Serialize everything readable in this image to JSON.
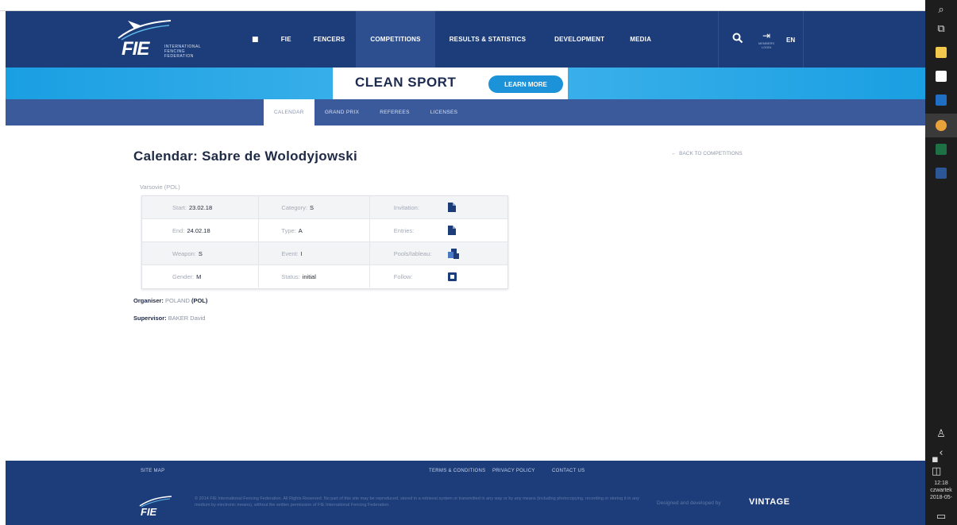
{
  "header": {
    "logo_text": "FIE",
    "logo_subtext": [
      "INTERNATIONAL",
      "FENCING",
      "FEDERATION"
    ],
    "nav": [
      {
        "label": "FIE"
      },
      {
        "label": "FENCERS"
      },
      {
        "label": "COMPETITIONS",
        "active": true
      },
      {
        "label": "RESULTS & STATISTICS"
      },
      {
        "label": "DEVELOPMENT"
      },
      {
        "label": "MEDIA"
      }
    ],
    "login_label": [
      "MEMBERS",
      "LOGIN"
    ],
    "language": "EN"
  },
  "banner": {
    "title": "CLEAN SPORT",
    "button": "LEARN MORE"
  },
  "subnav": [
    {
      "label": "CALENDAR",
      "active": true
    },
    {
      "label": "GRAND PRIX"
    },
    {
      "label": "REFEREES"
    },
    {
      "label": "LICENSES"
    }
  ],
  "main": {
    "title": "Calendar: Sabre de Wolodyjowski",
    "back_link": "BACK TO COMPETITIONS",
    "location": "Varsovie (POL)",
    "rows": [
      {
        "k1": "Start:",
        "v1": "23.02.18",
        "k2": "Category:",
        "v2": "S",
        "k3": "Invitation:",
        "icon": "document-icon"
      },
      {
        "k1": "End:",
        "v1": "24.02.18",
        "k2": "Type:",
        "v2": "A",
        "k3": "Entries:",
        "icon": "document-icon"
      },
      {
        "k1": "Weapon:",
        "v1": "S",
        "k2": "Event:",
        "v2": "I",
        "k3": "Pools/tableau:",
        "icon": "tableau-icon"
      },
      {
        "k1": "Gender:",
        "v1": "M",
        "k2": "Status:",
        "v2": "initial",
        "k3": "Follow:",
        "icon": "follow-icon"
      }
    ],
    "organiser_label": "Organiser:",
    "organiser_value": "POLAND",
    "organiser_code": "(POL)",
    "supervisor_label": "Supervisor:",
    "supervisor_value": "BAKER David"
  },
  "footer": {
    "site_map": "SITE MAP",
    "terms": "TERMS & CONDITIONS",
    "privacy": "PRIVACY POLICY",
    "contact": "CONTACT US",
    "copyright": "© 2014 FIE International Fencing Federation. All Rights Reserved. No part of this site may be reproduced, stored in a retrieval system or transmitted in any way or by any means (including photocopying, recording or storing it in any medium by electronic means), without the written permission of FIE International Fencing Federation.",
    "designed_by": "Designed and developed by",
    "agency": "VINTAGE"
  },
  "taskbar": {
    "time": "12:18",
    "day": "czwartek",
    "date": "2018-05-"
  },
  "colors": {
    "header_blue": "#1d3d7a",
    "nav_active": "#2d4f8f",
    "clean_sport_blue": "#1a9fe2",
    "subnav_blue": "#3a5a9c",
    "icon_blue": "#1d3d7a"
  }
}
